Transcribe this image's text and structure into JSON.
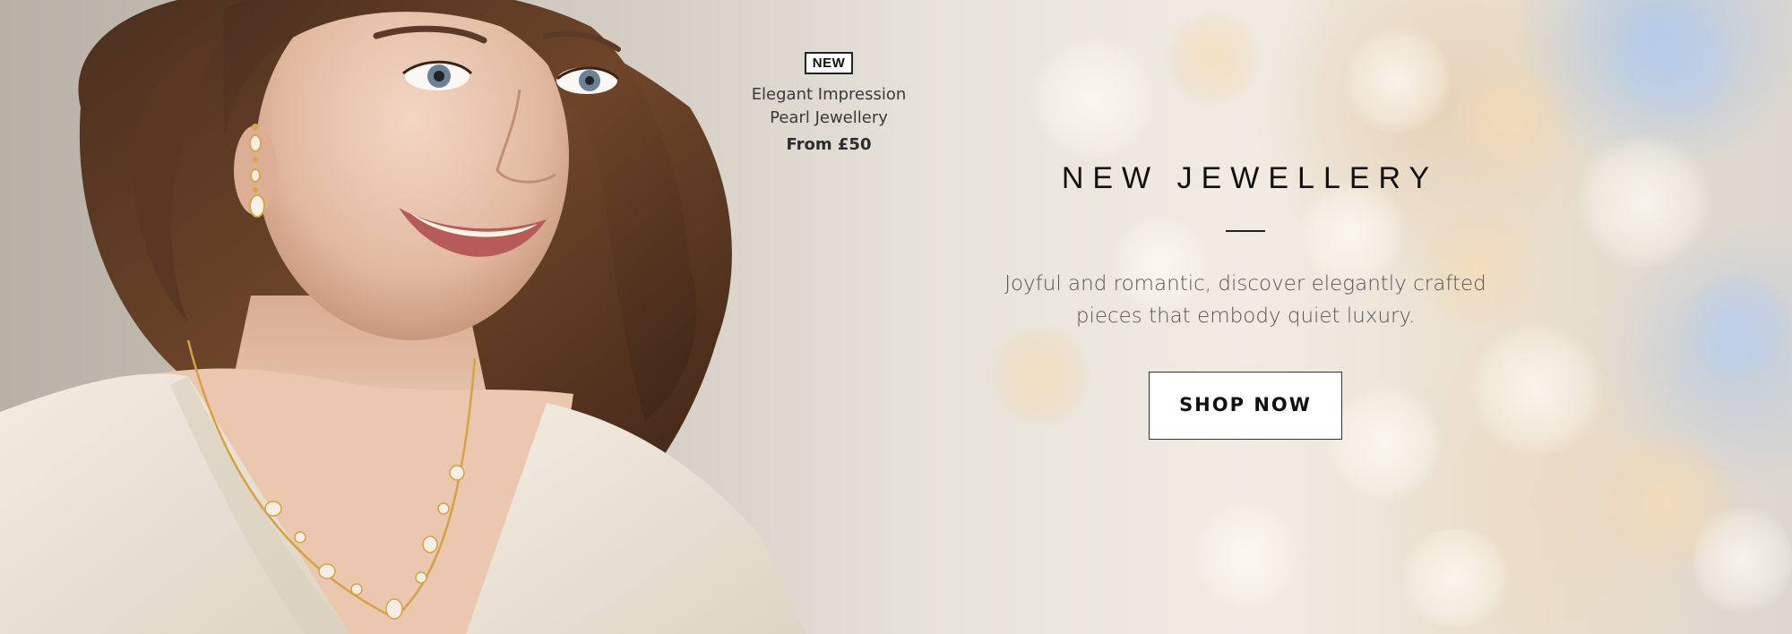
{
  "product_tag": {
    "badge": "NEW",
    "name_line1": "Elegant Impression",
    "name_line2": "Pearl Jewellery",
    "price": "From £50"
  },
  "hero": {
    "headline": "NEW JEWELLERY",
    "subtext_line1": "Joyful and romantic, discover elegantly crafted",
    "subtext_line2": "pieces that embody quiet luxury.",
    "cta_label": "SHOP NOW"
  },
  "image": {
    "subject": "model-photo"
  },
  "colors": {
    "text_dark": "#111111",
    "text_muted": "#555555",
    "button_bg": "#ffffff",
    "button_border": "#333333"
  }
}
